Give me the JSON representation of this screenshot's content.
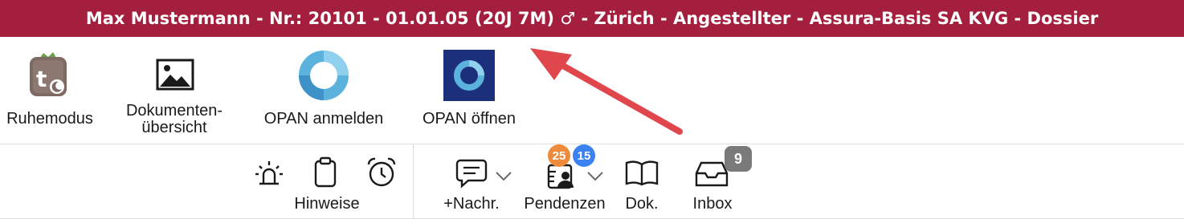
{
  "window": {
    "title": "Max Mustermann - Nr.: 20101 - 01.01.05 (20J 7M) ♂ - Zürich - Angestellter - Assura-Basis SA KVG - Dossier"
  },
  "toolbar_top": {
    "ruhemodus": "Ruhemodus",
    "dokumente_line1": "Dokumenten-",
    "dokumente_line2": "übersicht",
    "opan_anmelden": "OPAN anmelden",
    "opan_oeffnen": "OPAN öffnen"
  },
  "toolbar_bottom": {
    "hinweise": "Hinweise",
    "nachr": "+Nachr.",
    "pendenzen": "Pendenzen",
    "pendenzen_badge_orange": "25",
    "pendenzen_badge_blue": "15",
    "dok": "Dok.",
    "inbox": "Inbox",
    "inbox_badge": "9"
  },
  "colors": {
    "titlebar": "#a41f3d",
    "annotation_arrow": "#e0474c",
    "badge_orange": "#ee8a3c",
    "badge_blue": "#3b82f0",
    "badge_gray": "#7a7a7a"
  }
}
